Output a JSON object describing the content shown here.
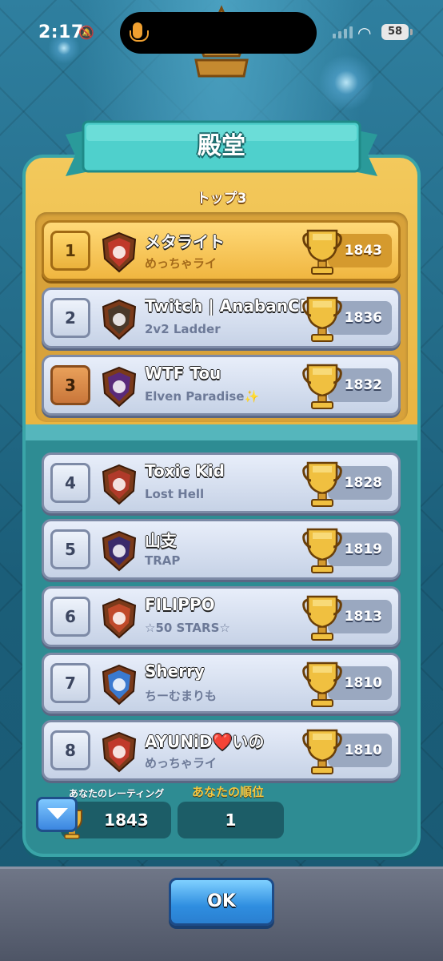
{
  "status_bar": {
    "time": "2:17",
    "battery": "58"
  },
  "header": {
    "title": "殿堂",
    "subtitle": "トップ3"
  },
  "rows": [
    {
      "rank": "1",
      "name": "メタライト",
      "clan": "めっちゃライ",
      "score": "1843",
      "badge_color": "#c0392b",
      "badge_icon": "flower-icon"
    },
    {
      "rank": "2",
      "name": "Twitch | AnabanCR",
      "clan": "2v2 Ladder",
      "score": "1836",
      "badge_color": "#4a3a2a",
      "badge_icon": "coin-icon"
    },
    {
      "rank": "3",
      "name": "WTF Tou",
      "clan": "Elven Paradise✨",
      "score": "1832",
      "badge_color": "#5a2a7a",
      "badge_icon": "star-burst-icon"
    },
    {
      "rank": "4",
      "name": "Toxic Kid",
      "clan": "Lost Hell",
      "score": "1828",
      "badge_color": "#b03a2a",
      "badge_icon": "mountain-icon"
    },
    {
      "rank": "5",
      "name": "山支",
      "clan": "TRAP",
      "score": "1819",
      "badge_color": "#3a2a6a",
      "badge_icon": "skull-icon"
    },
    {
      "rank": "6",
      "name": "FILIPPO",
      "clan": "☆50 STARS☆",
      "score": "1813",
      "badge_color": "#c04a2a",
      "badge_icon": "sunset-icon"
    },
    {
      "rank": "7",
      "name": "Sherry",
      "clan": "ちーむまりも",
      "score": "1810",
      "badge_color": "#3a7ad0",
      "badge_icon": "cross-icon"
    },
    {
      "rank": "8",
      "name": "AYUNiD❤️いの",
      "clan": "めっちゃライ",
      "score": "1810",
      "badge_color": "#c0392b",
      "badge_icon": "flower-icon"
    }
  ],
  "footer": {
    "rating_label": "あなたのレーティング",
    "rating_value": "1843",
    "rank_label": "あなたの順位",
    "rank_value": "1",
    "ok_label": "OK"
  },
  "colors": {
    "gold_panel": "#f3c95c",
    "teal_panel": "#2e8c93",
    "ok_button": "#2f8ee0"
  }
}
